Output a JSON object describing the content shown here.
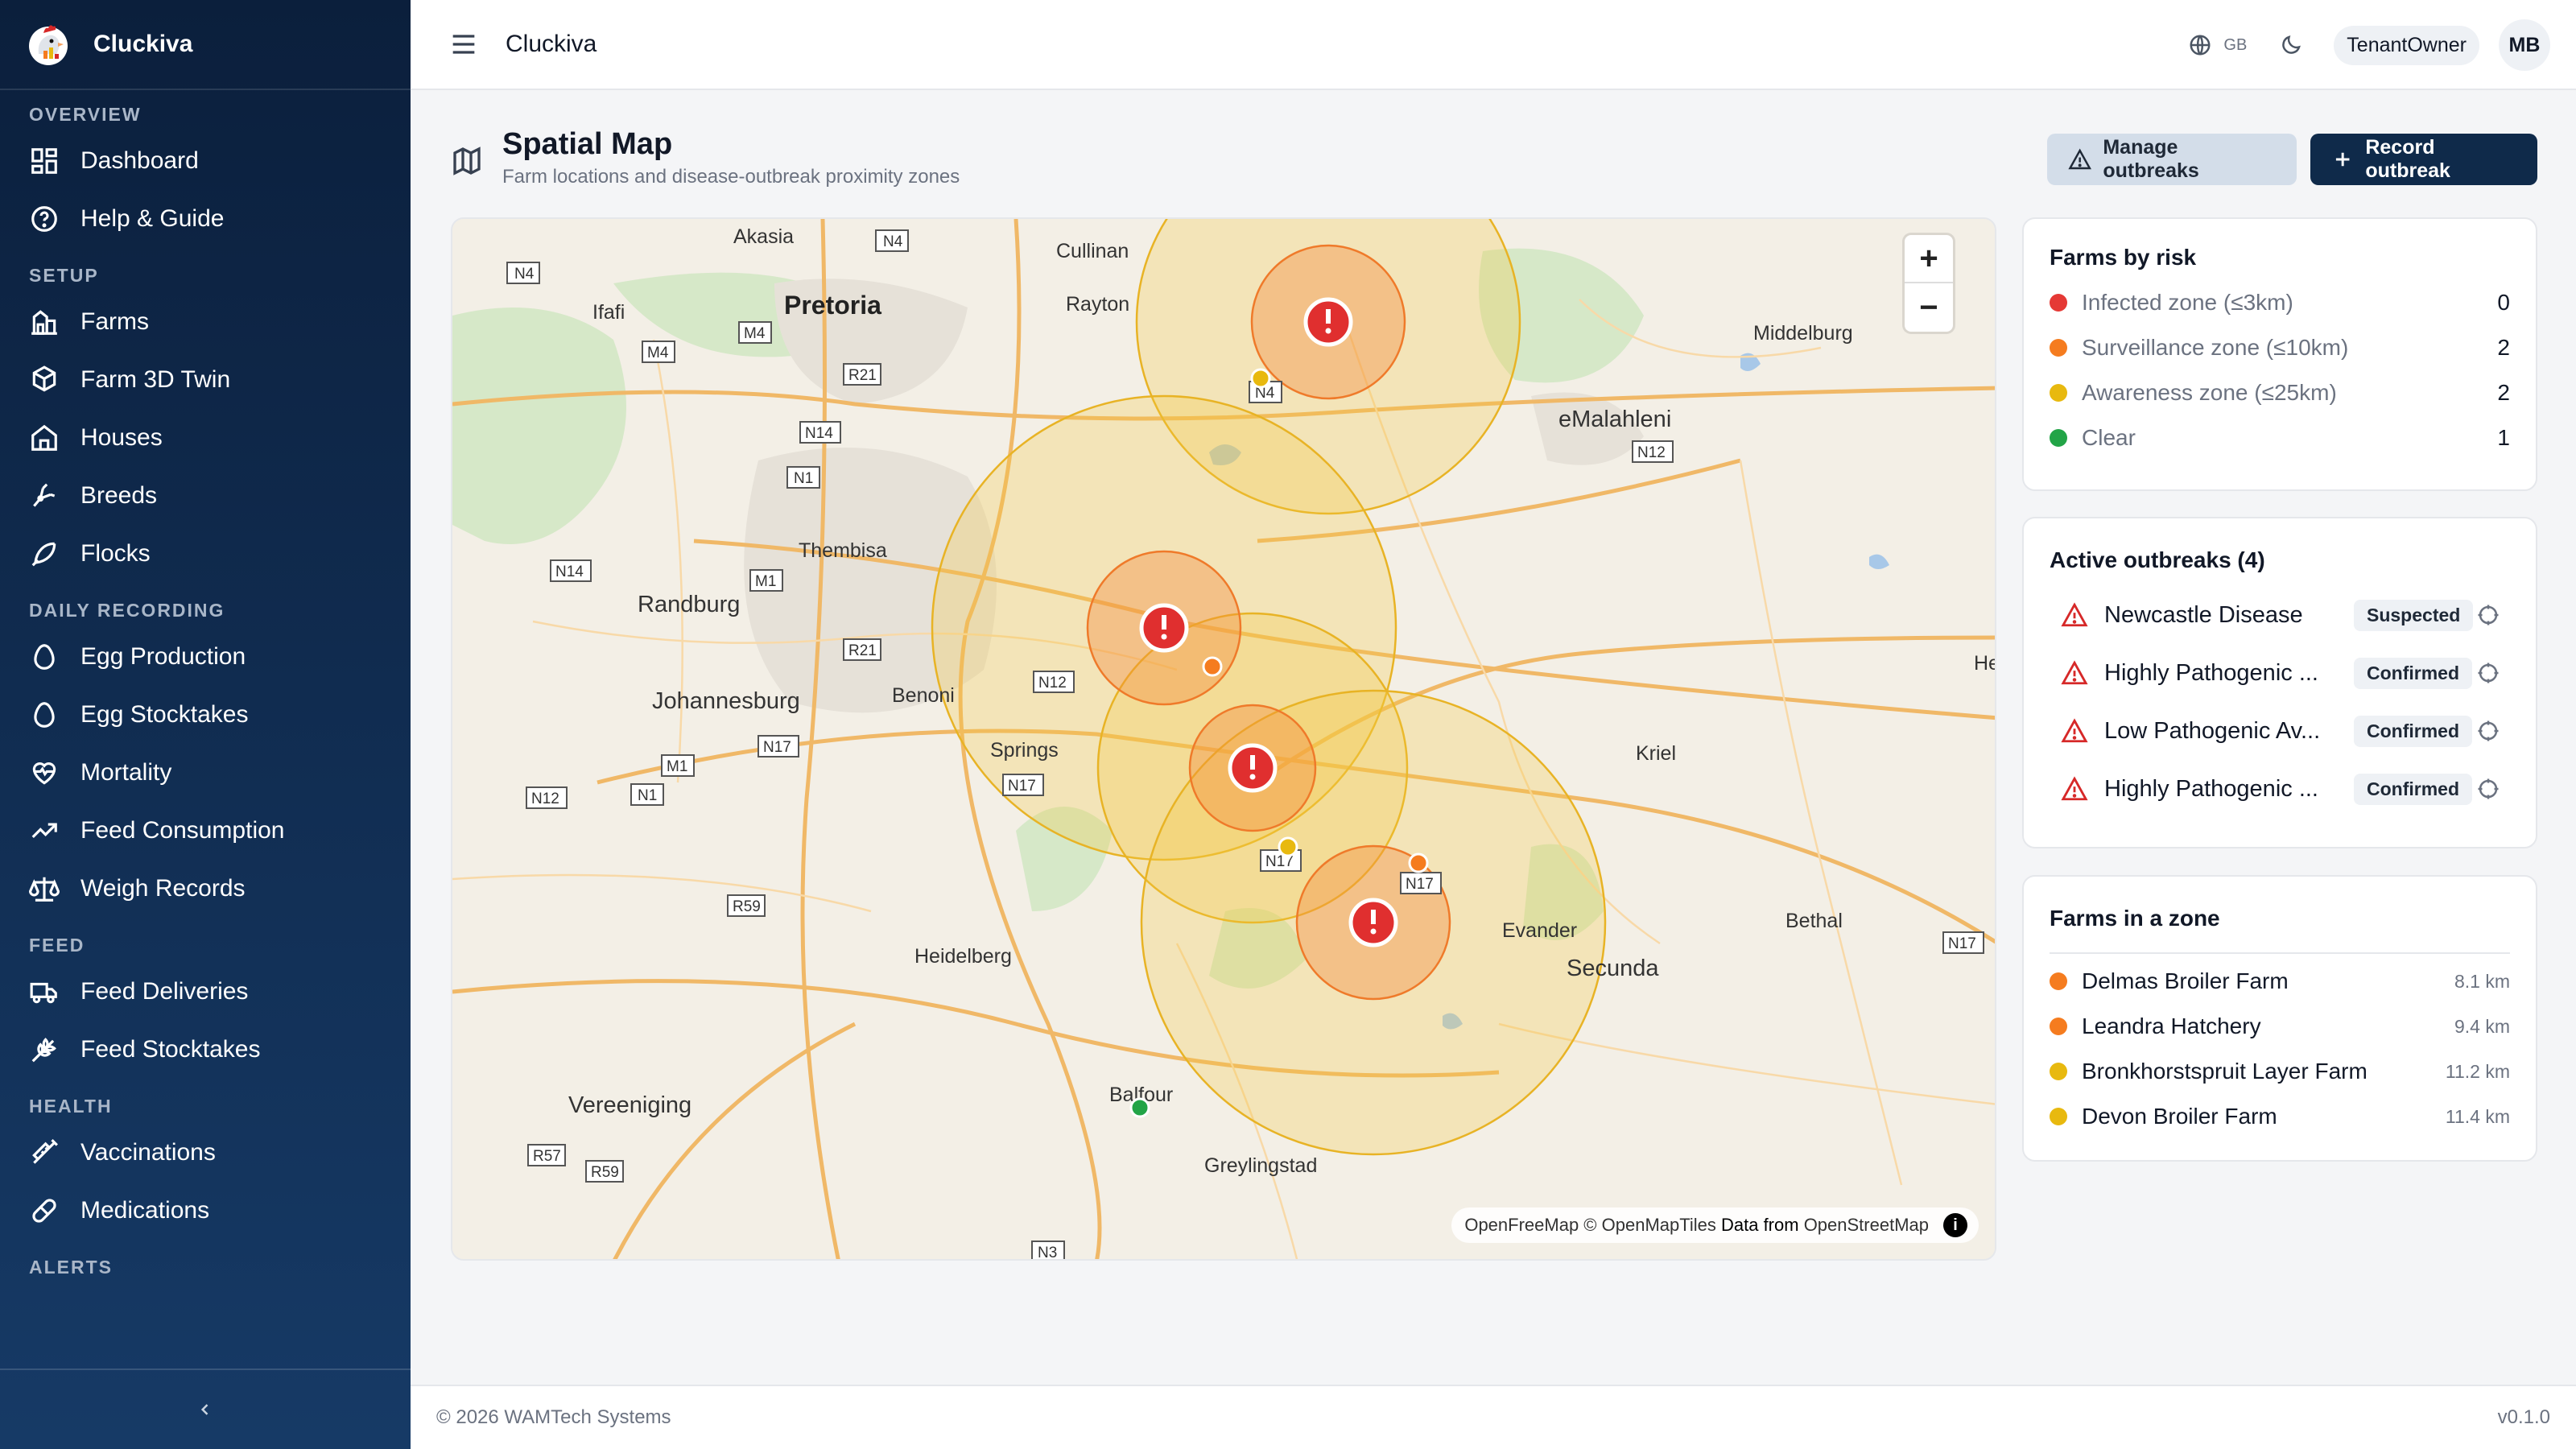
{
  "app": {
    "name": "Cluckiva"
  },
  "topbar": {
    "title": "Cluckiva",
    "lang": "GB",
    "role": "TenantOwner",
    "avatar": "MB"
  },
  "sidebar": {
    "sections": [
      {
        "title": "OVERVIEW",
        "items": [
          {
            "label": "Dashboard",
            "icon": "dashboard-icon"
          },
          {
            "label": "Help & Guide",
            "icon": "help-icon"
          }
        ]
      },
      {
        "title": "SETUP",
        "items": [
          {
            "label": "Farms",
            "icon": "farm-icon"
          },
          {
            "label": "Farm 3D Twin",
            "icon": "cube-icon"
          },
          {
            "label": "Houses",
            "icon": "house-icon"
          },
          {
            "label": "Breeds",
            "icon": "breed-icon"
          },
          {
            "label": "Flocks",
            "icon": "flock-icon"
          }
        ]
      },
      {
        "title": "DAILY RECORDING",
        "items": [
          {
            "label": "Egg Production",
            "icon": "egg-icon"
          },
          {
            "label": "Egg Stocktakes",
            "icon": "egg-icon"
          },
          {
            "label": "Mortality",
            "icon": "heart-icon"
          },
          {
            "label": "Feed Consumption",
            "icon": "trend-icon"
          },
          {
            "label": "Weigh Records",
            "icon": "scale-icon"
          }
        ]
      },
      {
        "title": "FEED",
        "items": [
          {
            "label": "Feed Deliveries",
            "icon": "truck-icon"
          },
          {
            "label": "Feed Stocktakes",
            "icon": "wheat-icon"
          }
        ]
      },
      {
        "title": "HEALTH",
        "items": [
          {
            "label": "Vaccinations",
            "icon": "syringe-icon"
          },
          {
            "label": "Medications",
            "icon": "pill-icon"
          }
        ]
      },
      {
        "title": "ALERTS",
        "items": []
      }
    ]
  },
  "page": {
    "title": "Spatial Map",
    "subtitle": "Farm locations and disease-outbreak proximity zones"
  },
  "actions": {
    "manage": "Manage outbreaks",
    "record": "Record outbreak"
  },
  "map": {
    "attribution": {
      "a": "OpenFreeMap",
      "b": " © ",
      "c": "OpenMapTiles",
      "d": " Data from ",
      "e": "OpenStreetMap"
    },
    "labels": [
      {
        "id": "akasia",
        "text": "Akasia"
      },
      {
        "id": "pretoria",
        "text": "Pretoria"
      },
      {
        "id": "ifafi",
        "text": "Ifafi"
      },
      {
        "id": "cullinan",
        "text": "Cullinan"
      },
      {
        "id": "rayton",
        "text": "Rayton"
      },
      {
        "id": "middelburg",
        "text": "Middelburg"
      },
      {
        "id": "emalahleni",
        "text": "eMalahleni"
      },
      {
        "id": "thembisa",
        "text": "Thembisa"
      },
      {
        "id": "randburg",
        "text": "Randburg"
      },
      {
        "id": "johannesburg",
        "text": "Johannesburg"
      },
      {
        "id": "benoni",
        "text": "Benoni"
      },
      {
        "id": "springs",
        "text": "Springs"
      },
      {
        "id": "kriel",
        "text": "Kriel"
      },
      {
        "id": "her",
        "text": "Her"
      },
      {
        "id": "heidelberg",
        "text": "Heidelberg"
      },
      {
        "id": "evander",
        "text": "Evander"
      },
      {
        "id": "secunda",
        "text": "Secunda"
      },
      {
        "id": "bethal",
        "text": "Bethal"
      },
      {
        "id": "vereeniging",
        "text": "Vereeniging"
      },
      {
        "id": "balfour",
        "text": "Balfour"
      },
      {
        "id": "greylingstad",
        "text": "Greylingstad"
      }
    ],
    "shields": [
      "N4",
      "N4",
      "M4",
      "M4",
      "R21",
      "N14",
      "N1",
      "M1",
      "N14",
      "R21",
      "N12",
      "N17",
      "M1",
      "N1",
      "N12",
      "N17",
      "R59",
      "N17",
      "N17",
      "N12",
      "N17",
      "R57",
      "R59",
      "N3",
      "N4"
    ]
  },
  "risk": {
    "title": "Farms by risk",
    "rows": [
      {
        "label": "Infected zone (≤3km)",
        "count": "0",
        "color": "#e53935"
      },
      {
        "label": "Surveillance zone (≤10km)",
        "count": "2",
        "color": "#f57c1f"
      },
      {
        "label": "Awareness zone (≤25km)",
        "count": "2",
        "color": "#e8b90f"
      },
      {
        "label": "Clear",
        "count": "1",
        "color": "#22a447"
      }
    ]
  },
  "outbreaks": {
    "title": "Active outbreaks (4)",
    "rows": [
      {
        "name": "Newcastle Disease",
        "status": "Suspected"
      },
      {
        "name": "Highly Pathogenic ...",
        "status": "Confirmed"
      },
      {
        "name": "Low Pathogenic Av...",
        "status": "Confirmed"
      },
      {
        "name": "Highly Pathogenic ...",
        "status": "Confirmed"
      }
    ]
  },
  "zone_farms": {
    "title": "Farms in a zone",
    "rows": [
      {
        "name": "Delmas Broiler Farm",
        "distance": "8.1 km",
        "color": "#f57c1f"
      },
      {
        "name": "Leandra Hatchery",
        "distance": "9.4 km",
        "color": "#f57c1f"
      },
      {
        "name": "Bronkhorstspruit Layer Farm",
        "distance": "11.2 km",
        "color": "#e8b90f"
      },
      {
        "name": "Devon Broiler Farm",
        "distance": "11.4 km",
        "color": "#e8b90f"
      }
    ]
  },
  "footer": {
    "copyright": "© 2026 WAMTech Systems",
    "version": "v0.1.0"
  }
}
